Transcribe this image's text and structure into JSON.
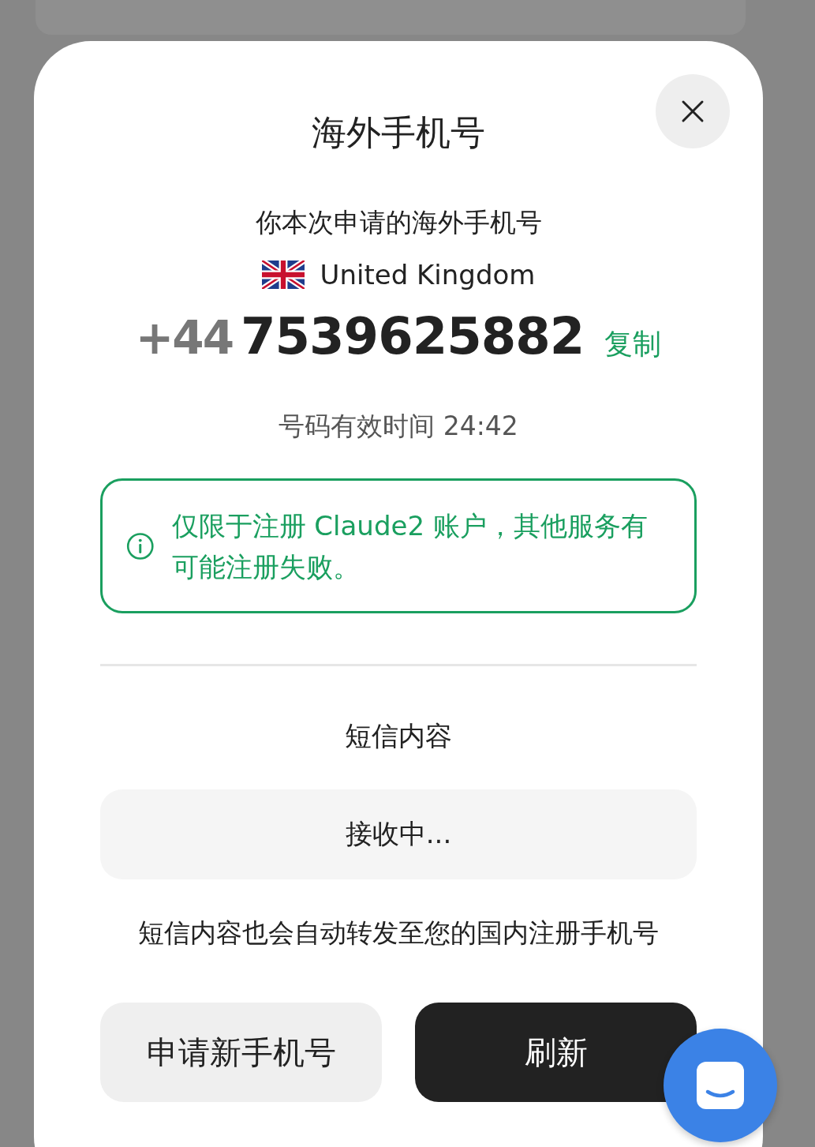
{
  "dialog": {
    "title": "海外手机号",
    "subtitle": "你本次申请的海外手机号",
    "country": "United Kingdom",
    "country_code": "+44",
    "number": "7539625882",
    "copy_link": "复制",
    "validity": "号码有效时间 24:42"
  },
  "notice": {
    "text": "仅限于注册 Claude2 账户，其他服务有可能注册失败。"
  },
  "sms": {
    "heading": "短信内容",
    "status": "接收中...",
    "note": "短信内容也会自动转发至您的国内注册手机号"
  },
  "buttons": [
    {
      "label": "申请新手机号",
      "kind": "secondary"
    },
    {
      "label": "刷新",
      "kind": "primary"
    }
  ]
}
